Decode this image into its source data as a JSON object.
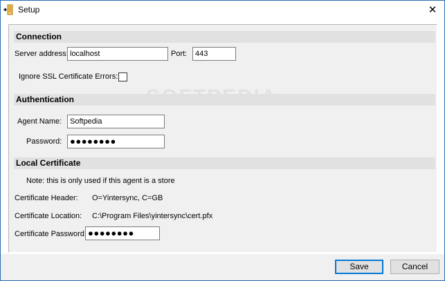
{
  "window": {
    "title": "Setup",
    "close_glyph": "✕",
    "icon": "setup-app-icon"
  },
  "connection": {
    "header": "Connection",
    "server_label": "Server address:",
    "server_value": "localhost",
    "port_label": "Port:",
    "port_value": "443",
    "ignore_ssl_label": "Ignore SSL Certificate Errors:",
    "ignore_ssl_checked": false
  },
  "authentication": {
    "header": "Authentication",
    "agent_label": "Agent Name:",
    "agent_value": "Softpedia",
    "password_label": "Password:",
    "password_mask": "●●●●●●●●"
  },
  "local_certificate": {
    "header": "Local Certificate",
    "note": "Note: this is only used if this agent is a store",
    "header_label": "Certificate Header:",
    "header_value": "O=Yintersync, C=GB",
    "location_label": "Certificate Location:",
    "location_value": "C:\\Program Files\\yintersync\\cert.pfx",
    "password_label": "Certificate Password:",
    "password_mask": "●●●●●●●●"
  },
  "buttons": {
    "save": "Save",
    "cancel": "Cancel"
  },
  "watermark": "SOFTPEDIA"
}
